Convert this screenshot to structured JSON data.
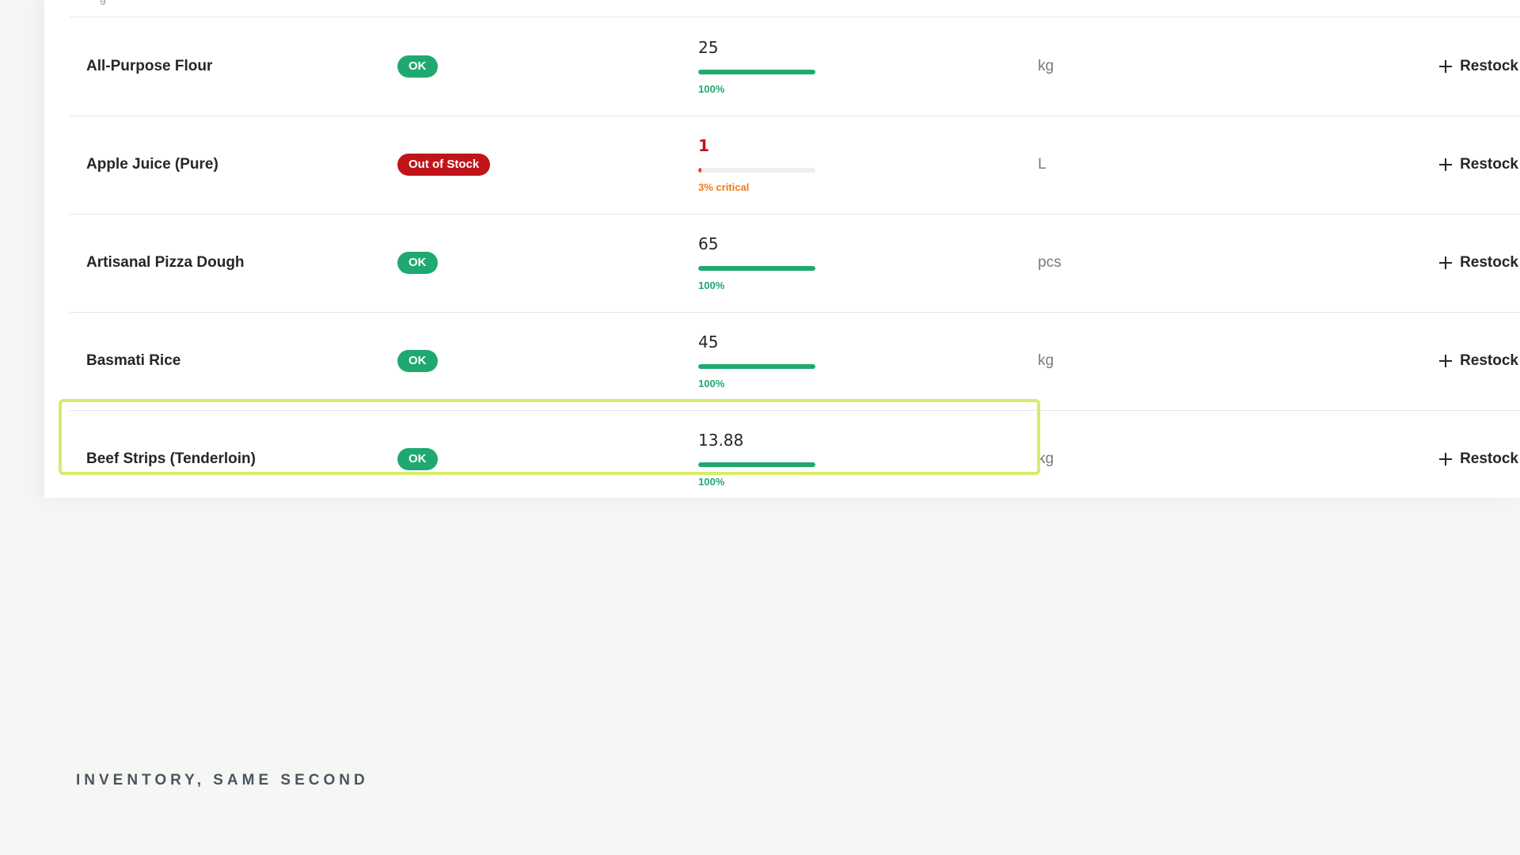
{
  "table": {
    "header_fragment": "g",
    "rows": [
      {
        "name": "All-Purpose Flour",
        "status": "OK",
        "status_type": "ok",
        "quantity": "25",
        "level_percent": 100,
        "level_label": "100%",
        "unit": "kg",
        "action_label": "Restock"
      },
      {
        "name": "Apple Juice (Pure)",
        "status": "Out of Stock",
        "status_type": "out",
        "quantity": "1",
        "level_percent": 3,
        "level_label": "3% critical",
        "unit": "L",
        "action_label": "Restock"
      },
      {
        "name": "Artisanal Pizza Dough",
        "status": "OK",
        "status_type": "ok",
        "quantity": "65",
        "level_percent": 100,
        "level_label": "100%",
        "unit": "pcs",
        "action_label": "Restock"
      },
      {
        "name": "Basmati Rice",
        "status": "OK",
        "status_type": "ok",
        "quantity": "45",
        "level_percent": 100,
        "level_label": "100%",
        "unit": "kg",
        "action_label": "Restock"
      },
      {
        "name": "Beef Strips (Tenderloin)",
        "status": "OK",
        "status_type": "ok",
        "quantity": "13.88",
        "level_percent": 100,
        "level_label": "100%",
        "unit": "kg",
        "action_label": "Restock"
      }
    ],
    "highlighted_row": 4
  },
  "caption": "INVENTORY, SAME SECOND",
  "colors": {
    "ok": "#1fa971",
    "out_of_stock": "#c0141a",
    "critical_bar": "#e0452a",
    "critical_text": "#f07a16",
    "highlight": "#d8ea6b"
  }
}
